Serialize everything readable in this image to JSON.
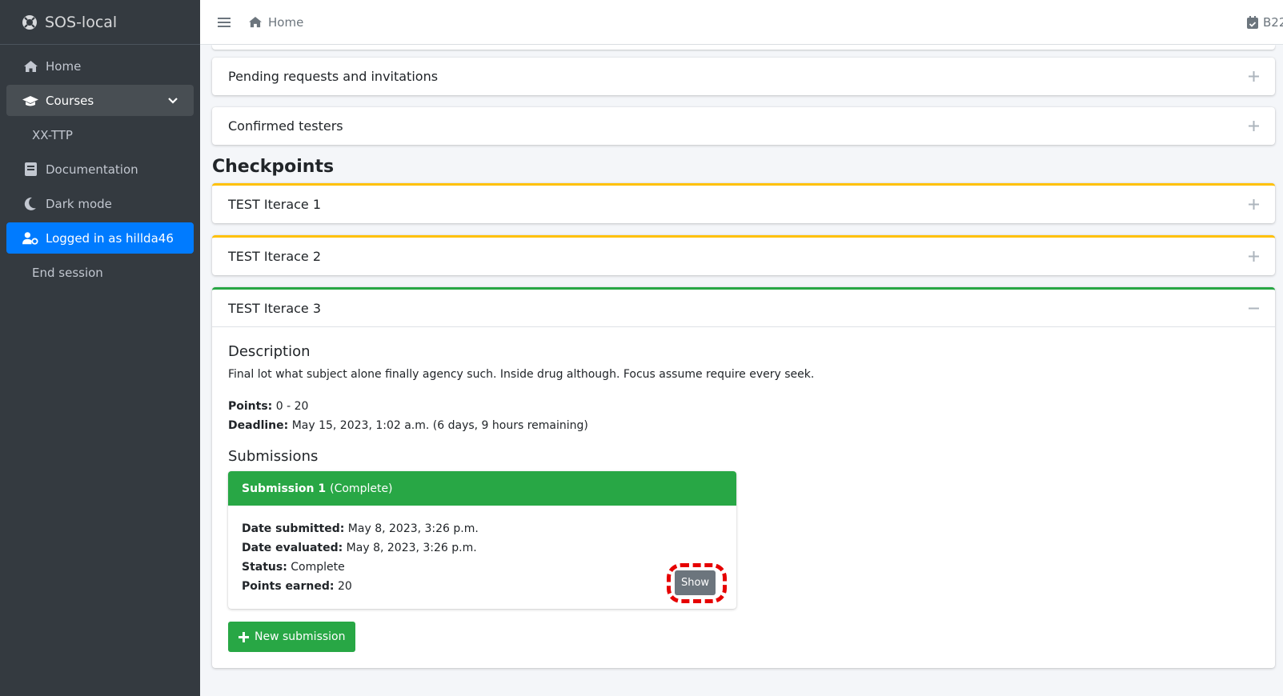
{
  "sidebar": {
    "brand": "SOS-local",
    "items": [
      {
        "label": "Home"
      },
      {
        "label": "Courses"
      },
      {
        "label": "XX-TTP"
      },
      {
        "label": "Documentation"
      },
      {
        "label": "Dark mode"
      },
      {
        "label": "Logged in as hillda46"
      },
      {
        "label": "End session"
      }
    ]
  },
  "header": {
    "home_label": "Home",
    "right_label": "B22"
  },
  "main": {
    "pending_label": "Pending requests and invitations",
    "confirmed_label": "Confirmed testers",
    "checkpoints_title": "Checkpoints",
    "checkpoints": [
      {
        "title": "TEST Iterace 1",
        "status_color": "#ffc107"
      },
      {
        "title": "TEST Iterace 2",
        "status_color": "#ffc107"
      },
      {
        "title": "TEST Iterace 3",
        "status_color": "#28a745"
      }
    ],
    "detail": {
      "description_title": "Description",
      "description_text": "Final lot what subject alone finally agency such. Inside drug although. Focus assume require every seek.",
      "points_label": "Points:",
      "points_value": "0 - 20",
      "deadline_label": "Deadline:",
      "deadline_value": "May 15, 2023, 1:02 a.m. (6 days, 9 hours remaining)",
      "submissions_title": "Submissions",
      "submission": {
        "name": "Submission 1",
        "state": "(Complete)",
        "date_submitted_label": "Date submitted:",
        "date_submitted": "May 8, 2023, 3:26 p.m.",
        "date_evaluated_label": "Date evaluated:",
        "date_evaluated": "May 8, 2023, 3:26 p.m.",
        "status_label": "Status:",
        "status": "Complete",
        "points_earned_label": "Points earned:",
        "points_earned": "20",
        "show_label": "Show"
      },
      "new_submission_label": "New submission"
    }
  },
  "colors": {
    "sidebar_bg": "#343a40",
    "active": "#007bff",
    "success": "#28a745",
    "warning": "#ffc107",
    "highlight": "#e60000"
  }
}
